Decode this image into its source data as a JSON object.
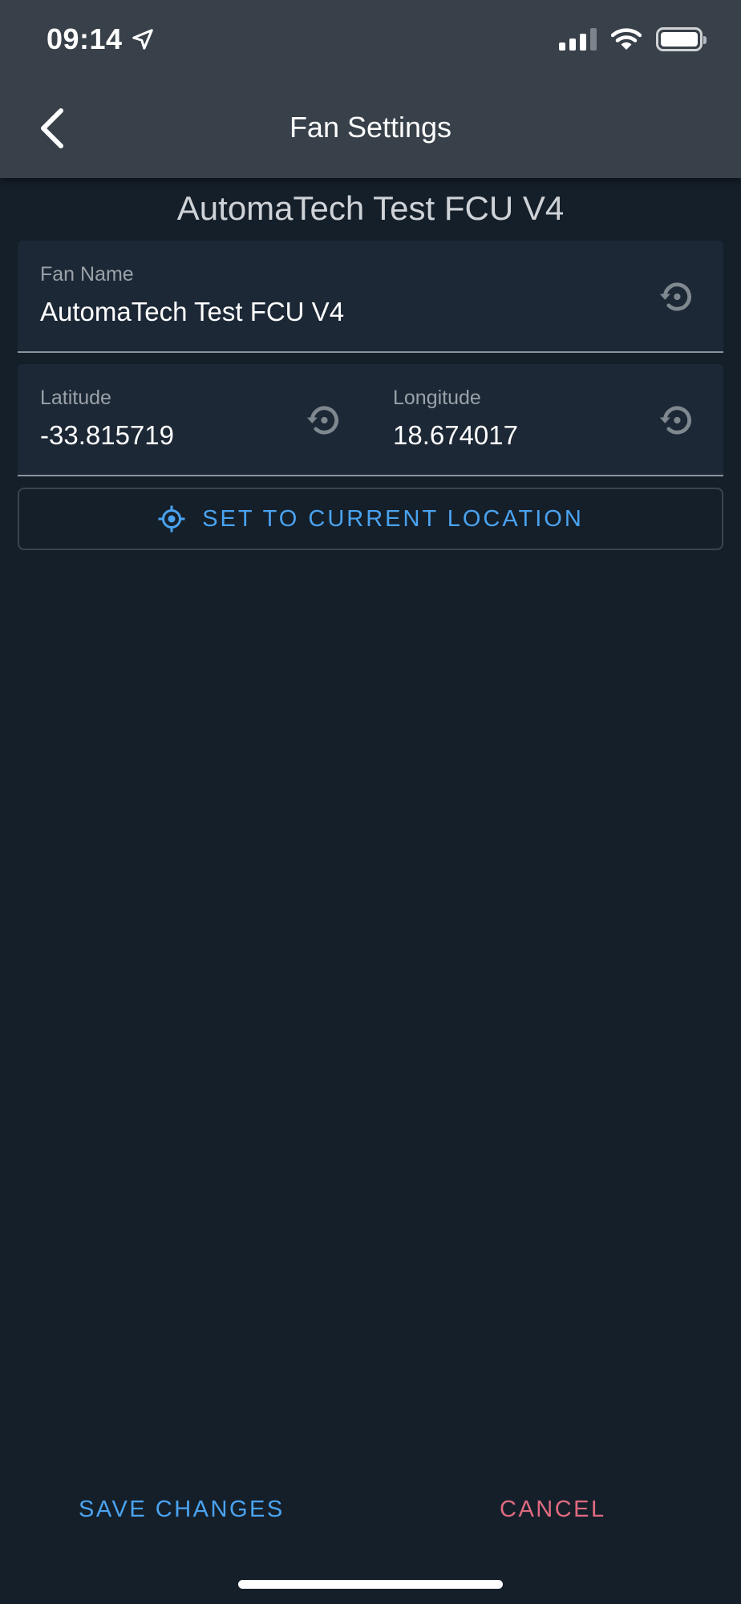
{
  "status_bar": {
    "time": "09:14"
  },
  "header": {
    "title": "Fan Settings"
  },
  "device": {
    "title": "AutomaTech Test FCU V4"
  },
  "fields": {
    "fan_name": {
      "label": "Fan Name",
      "value": "AutomaTech Test FCU V4"
    },
    "latitude": {
      "label": "Latitude",
      "value": "-33.815719"
    },
    "longitude": {
      "label": "Longitude",
      "value": "18.674017"
    }
  },
  "actions": {
    "set_location": "SET TO CURRENT LOCATION",
    "save": "SAVE CHANGES",
    "cancel": "CANCEL"
  },
  "colors": {
    "background": "#151f2a",
    "header": "#384049",
    "field_bg": "#1d2836",
    "accent_blue": "#4aa3f0",
    "cancel_red": "#e06a7f"
  },
  "icons": {
    "back": "chevron-left-icon",
    "reset": "restore-icon",
    "location": "crosshair-icon"
  }
}
